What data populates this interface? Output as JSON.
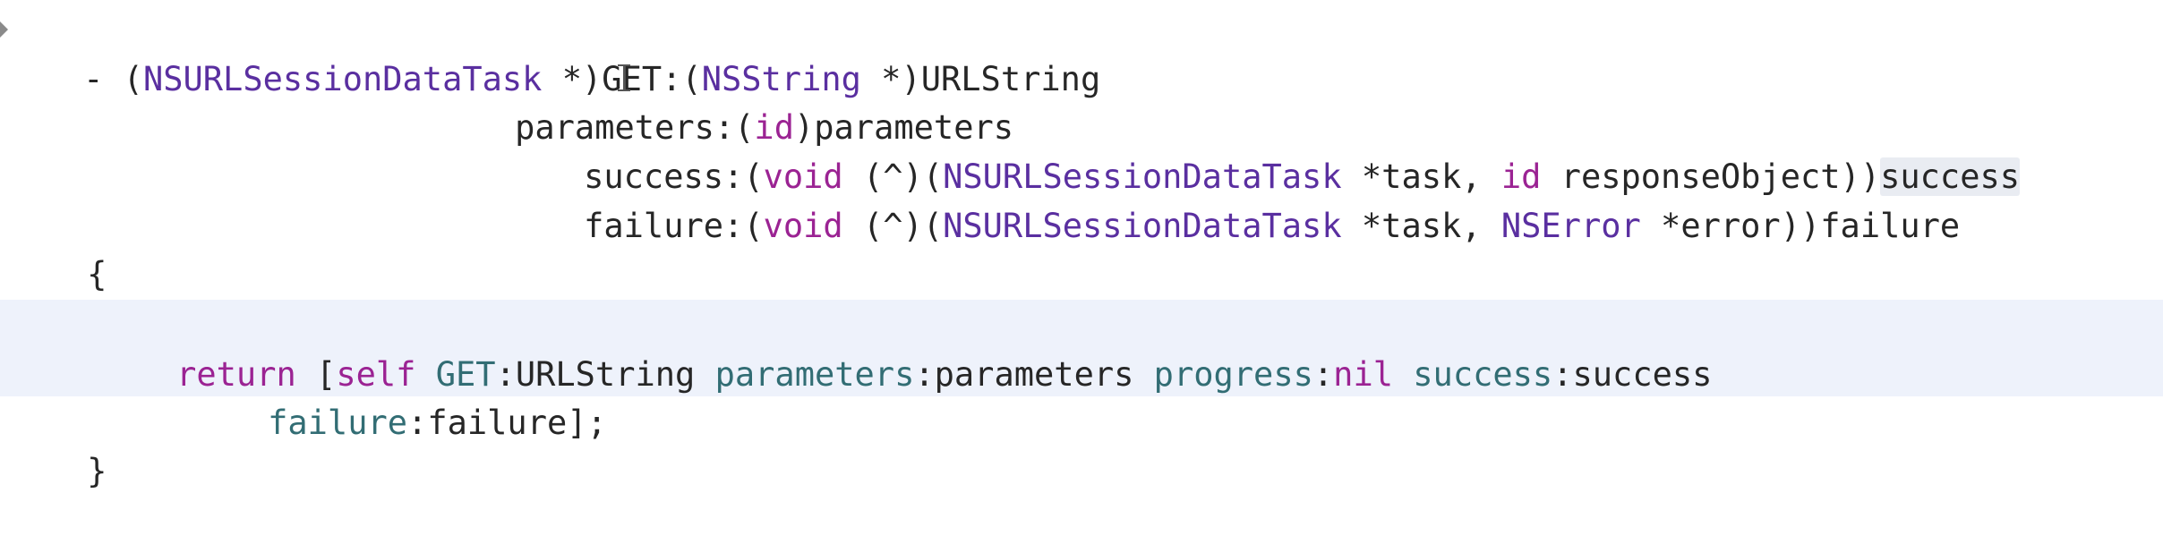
{
  "code": {
    "line1": [
      "- (",
      "NSURLSessionDataTask",
      " *)GET:(",
      "NSString",
      " *)URLString"
    ],
    "line2": [
      "parameters:(",
      "id",
      ")parameters"
    ],
    "line3": [
      "success:(",
      "void",
      " (^)(",
      "NSURLSessionDataTask",
      " *task, ",
      "id",
      " responseObject))",
      "success"
    ],
    "line4": [
      "failure:(",
      "void",
      " (^)(",
      "NSURLSessionDataTask",
      " *task, ",
      "NSError",
      " *error))failure"
    ],
    "line5": [
      "{"
    ],
    "line7": [
      "return",
      " [",
      "self",
      " ",
      "GET",
      ":URLString ",
      "parameters",
      ":parameters ",
      "progress",
      ":",
      "nil",
      " ",
      "success",
      ":success"
    ],
    "line8": [
      "failure",
      ":failure];"
    ],
    "line9": [
      "}"
    ]
  },
  "colors": {
    "text": "#262626",
    "type": "#5a2fa0",
    "keyword": "#9b2393",
    "selector": "#326d74",
    "current_line": "#eef2fb"
  },
  "icons": {
    "gutter_marker": "triangle-right-icon",
    "cursor": "ibeam-cursor-icon"
  }
}
